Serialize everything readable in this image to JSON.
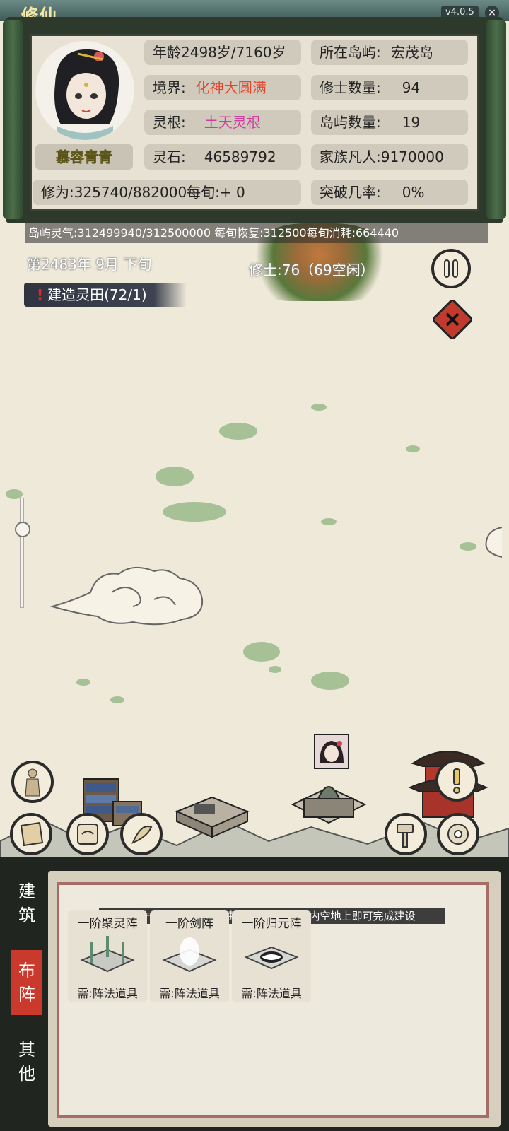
{
  "header": {
    "title": "修仙",
    "version": "v4.0.5"
  },
  "character": {
    "name": "慕容青青",
    "age_label": "年龄2498岁/7160岁",
    "realm_label": "境界:",
    "realm_value": "化神大圆满",
    "root_label": "灵根:",
    "root_value": "土天灵根",
    "stones_label": "灵石:",
    "stones_value": "46589792",
    "cultivation_label": "修为:325740/882000每旬:+  0"
  },
  "island": {
    "island_label": "所在岛屿:",
    "island_value": "宏茂岛",
    "cultivators_label": "修士数量:",
    "cultivators_value": "94",
    "islands_label": "岛屿数量:",
    "islands_value": "19",
    "mortals_label": "家族凡人:9170000",
    "breakthrough_label": "突破几率:",
    "breakthrough_value": "0%"
  },
  "map": {
    "info_bar": "岛屿灵气:312499940/312500000 每旬恢复:312500每旬消耗:664440",
    "date": "第2483年 9月 下旬",
    "cultivators_count": "修士:76（69空闲）",
    "task": "建造灵田(72/1)"
  },
  "bottom": {
    "tabs": [
      {
        "label": "建筑",
        "active": false
      },
      {
        "label": "布阵",
        "active": true
      },
      {
        "label": "其他",
        "active": false
      }
    ],
    "hint": "操作方式：点击下面建筑，拖动至岛屿内空地上即可完成建设",
    "items": [
      {
        "title": "一阶聚灵阵",
        "req": "需:阵法道具"
      },
      {
        "title": "一阶剑阵",
        "req": "需:阵法道具"
      },
      {
        "title": "一阶归元阵",
        "req": "需:阵法道具"
      }
    ]
  },
  "colors": {
    "accent_red": "#c9392c",
    "realm": "#e8442c",
    "root": "#d43b9f",
    "name": "#e6d22f"
  },
  "icons": {
    "pause": "pause-icon",
    "close": "close-icon",
    "disciple": "disciple-icon",
    "map": "map-scroll-icon",
    "scroll": "scroll-icon",
    "tome": "tome-icon",
    "alert": "alert-icon",
    "hammer": "hammer-icon",
    "flower": "flower-icon"
  }
}
